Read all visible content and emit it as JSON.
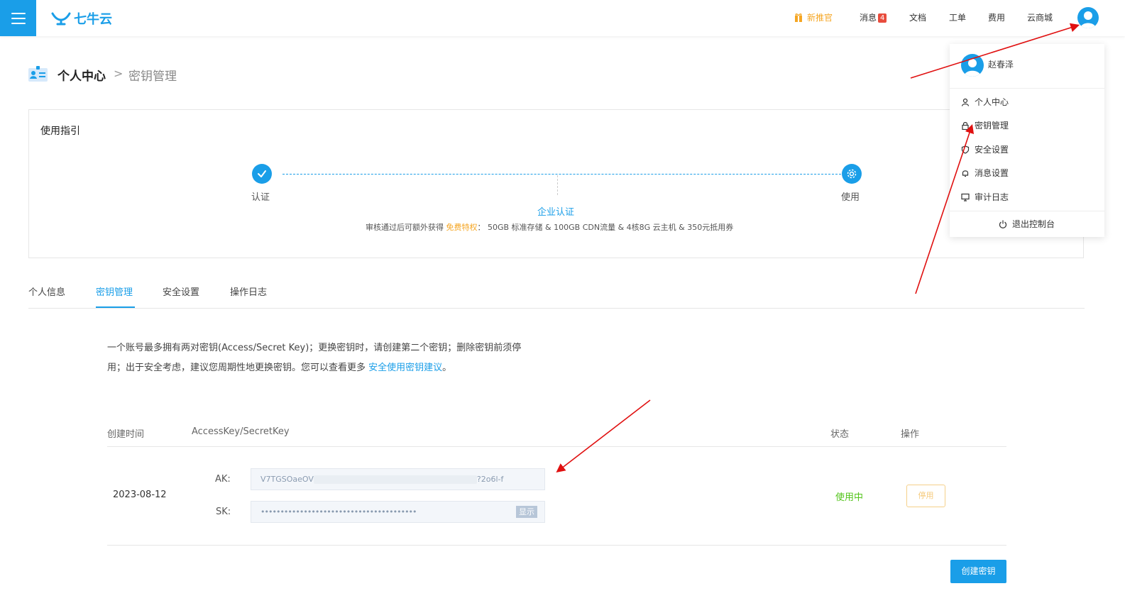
{
  "topbar": {
    "logo": "七牛云",
    "nav": [
      {
        "key": "promo",
        "label": "新推官"
      },
      {
        "key": "messages",
        "label": "消息",
        "badge": "4"
      },
      {
        "key": "docs",
        "label": "文档"
      },
      {
        "key": "tickets",
        "label": "工单"
      },
      {
        "key": "billing",
        "label": "费用"
      },
      {
        "key": "market",
        "label": "云商城"
      }
    ]
  },
  "breadcrumb": {
    "main": "个人中心",
    "separator": ">",
    "current": "密钥管理"
  },
  "guide": {
    "title": "使用指引",
    "step1": "认证",
    "step2": "使用",
    "enterprise_link": "企业认证",
    "benefit_prefix": "审核通过后可额外获得",
    "benefit_free": "免费特权",
    "benefit_suffix": "： 50GB 标准存储 & 100GB CDN流量 & 4核8G 云主机 & 350元抵用券"
  },
  "tabs": [
    {
      "label": "个人信息",
      "active": false
    },
    {
      "label": "密钥管理",
      "active": true
    },
    {
      "label": "安全设置",
      "active": false
    },
    {
      "label": "操作日志",
      "active": false
    }
  ],
  "info": {
    "line1": "一个账号最多拥有两对密钥(Access/Secret Key)；更换密钥时，请创建第二个密钥；删除密钥前须停",
    "line2": "用；出于安全考虑，建议您周期性地更换密钥。您可以查看更多",
    "link": "安全使用密钥建议",
    "end": "。"
  },
  "table": {
    "headers": {
      "created": "创建时间",
      "keys": "AccessKey/SecretKey",
      "status": "状态",
      "action": "操作"
    },
    "row": {
      "date": "2023-08-12",
      "ak_label": "AK:",
      "ak_value_start": "V7TGSOaeOV",
      "ak_value_end": "?2o6l-f",
      "sk_label": "SK:",
      "sk_value": "••••••••••••••••••••••••••••••••••••••••",
      "show_button": "显示",
      "status": "使用中",
      "disable_button": "停用"
    }
  },
  "create_button": "创建密钥",
  "dropdown": {
    "username": "赵春泽",
    "items": [
      "个人中心",
      "密钥管理",
      "安全设置",
      "消息设置",
      "审计日志"
    ],
    "logout": "退出控制台"
  },
  "colors": {
    "accent": "#1a9ee8",
    "promo": "#f5a623",
    "success": "#52c41a",
    "arrow": "#e01010"
  }
}
